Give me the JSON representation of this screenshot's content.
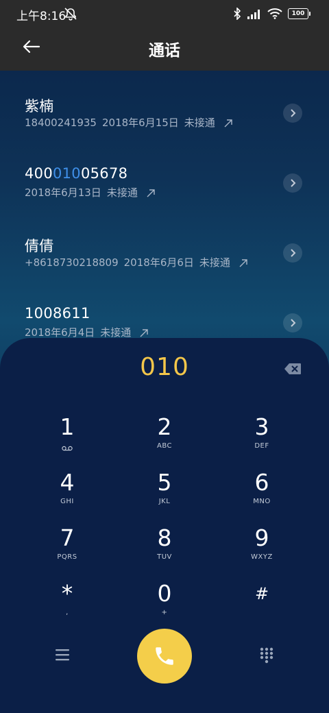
{
  "status_bar": {
    "time": "上午8:16",
    "battery": "100",
    "icons": [
      "mute-notification-icon",
      "bluetooth-icon",
      "signal-icon",
      "wifi-icon",
      "battery-icon"
    ]
  },
  "header": {
    "title": "通话",
    "back_icon": "back-arrow-icon"
  },
  "call_log": [
    {
      "name": "紫楠",
      "name_parts": [],
      "number": "18400241935",
      "date": "2018年6月15日",
      "status": "未接通"
    },
    {
      "name": "4001005678",
      "name_parts": [
        {
          "text": "400",
          "highlight": false
        },
        {
          "text": "010",
          "highlight": true
        },
        {
          "text": "05678",
          "highlight": false
        }
      ],
      "number": "",
      "date": "2018年6月13日",
      "status": "未接通"
    },
    {
      "name": "倩倩",
      "name_parts": [],
      "number": "+8618730218809",
      "date": "2018年6月6日",
      "status": "未接通"
    },
    {
      "name": "1008611",
      "name_parts": [],
      "number": "",
      "date": "2018年6月4日",
      "status": "未接通"
    }
  ],
  "dialer": {
    "input": "010",
    "keys": [
      {
        "digit": "1",
        "letters": "voicemail-icon"
      },
      {
        "digit": "2",
        "letters": "ABC"
      },
      {
        "digit": "3",
        "letters": "DEF"
      },
      {
        "digit": "4",
        "letters": "GHI"
      },
      {
        "digit": "5",
        "letters": "JKL"
      },
      {
        "digit": "6",
        "letters": "MNO"
      },
      {
        "digit": "7",
        "letters": "PQRS"
      },
      {
        "digit": "8",
        "letters": "TUV"
      },
      {
        "digit": "9",
        "letters": "WXYZ"
      },
      {
        "digit": "*",
        "letters": ","
      },
      {
        "digit": "0",
        "letters": "+"
      },
      {
        "digit": "#",
        "letters": ""
      }
    ],
    "colors": {
      "accent": "#f4ce4a",
      "highlight": "#3f8fe8",
      "panel": "#0b1f47"
    }
  }
}
